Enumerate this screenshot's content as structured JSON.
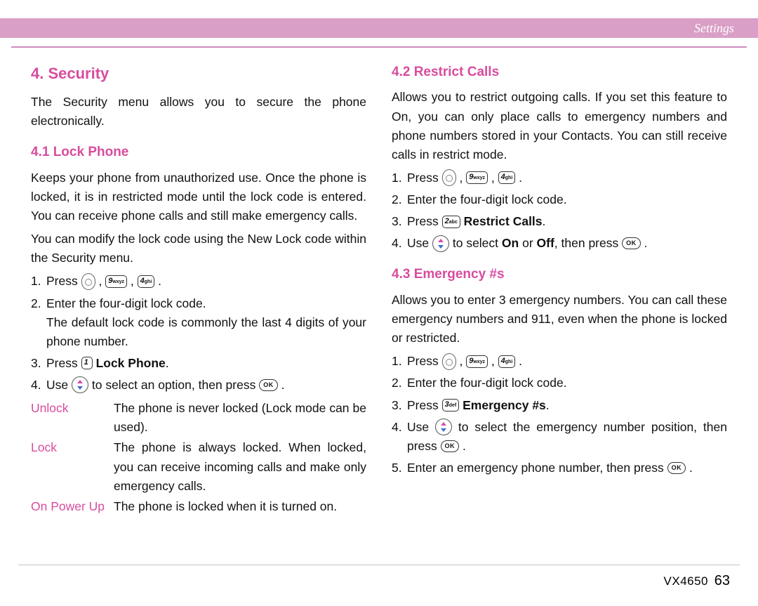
{
  "header": {
    "section_label": "Settings"
  },
  "left": {
    "h2": "4. Security",
    "intro": "The Security menu allows you to secure the phone electronically.",
    "s41": {
      "title": "4.1 Lock Phone",
      "p1": "Keeps your phone from unauthorized use. Once the phone is locked, it is in restricted mode until the lock code is entered. You can receive phone calls and still make emergency calls.",
      "p2": "You can modify the lock code using the New Lock code within the Security menu.",
      "steps": {
        "s1a": "Press ",
        "s2a": "Enter the four-digit lock code.",
        "s2b": "The default lock code is commonly the last 4 digits of your phone number.",
        "s3a": "Press ",
        "s3b": "Lock Phone",
        "s4a": "Use ",
        "s4b": " to select an option, then press "
      },
      "opts": [
        {
          "label": "Unlock",
          "desc": "The phone is never locked (Lock mode can be used)."
        },
        {
          "label": "Lock",
          "desc": "The phone is always locked. When locked, you can receive incoming calls and make only emergency calls."
        },
        {
          "label": "On Power Up",
          "desc": "The phone is locked when it is turned on."
        }
      ]
    }
  },
  "right": {
    "s42": {
      "title": "4.2 Restrict Calls",
      "p1": "Allows you to restrict outgoing calls. If you set this feature to On, you can only place calls to emergency numbers and phone numbers stored in your Contacts. You can still receive calls in restrict mode.",
      "steps": {
        "s1a": "Press ",
        "s2a": "Enter the four-digit lock code.",
        "s3a": "Press ",
        "s3b": "Restrict Calls",
        "s4a": "Use ",
        "s4b": " to select ",
        "s4c": "On",
        "s4d": " or ",
        "s4e": "Off",
        "s4f": ", then press "
      }
    },
    "s43": {
      "title": "4.3 Emergency #s",
      "p1": "Allows you to enter 3 emergency numbers. You can call these emergency numbers and 911, even when the phone is locked or restricted.",
      "steps": {
        "s1a": "Press ",
        "s2a": "Enter the four-digit lock code.",
        "s3a": "Press ",
        "s3b": "Emergency #s",
        "s4a": "Use ",
        "s4b": " to select the emergency number position, then press ",
        "s5a": "Enter an emergency phone number, then press "
      }
    }
  },
  "keys": {
    "k1_big": "1",
    "k1_tiny": "",
    "k2_big": "2",
    "k2_tiny": "abc",
    "k3_big": "3",
    "k3_tiny": "def",
    "k4_big": "4",
    "k4_tiny": "ghi",
    "k9_big": "9",
    "k9_tiny": "wxyz",
    "ok": "OK"
  },
  "footer": {
    "model": "VX4650",
    "page": "63"
  }
}
